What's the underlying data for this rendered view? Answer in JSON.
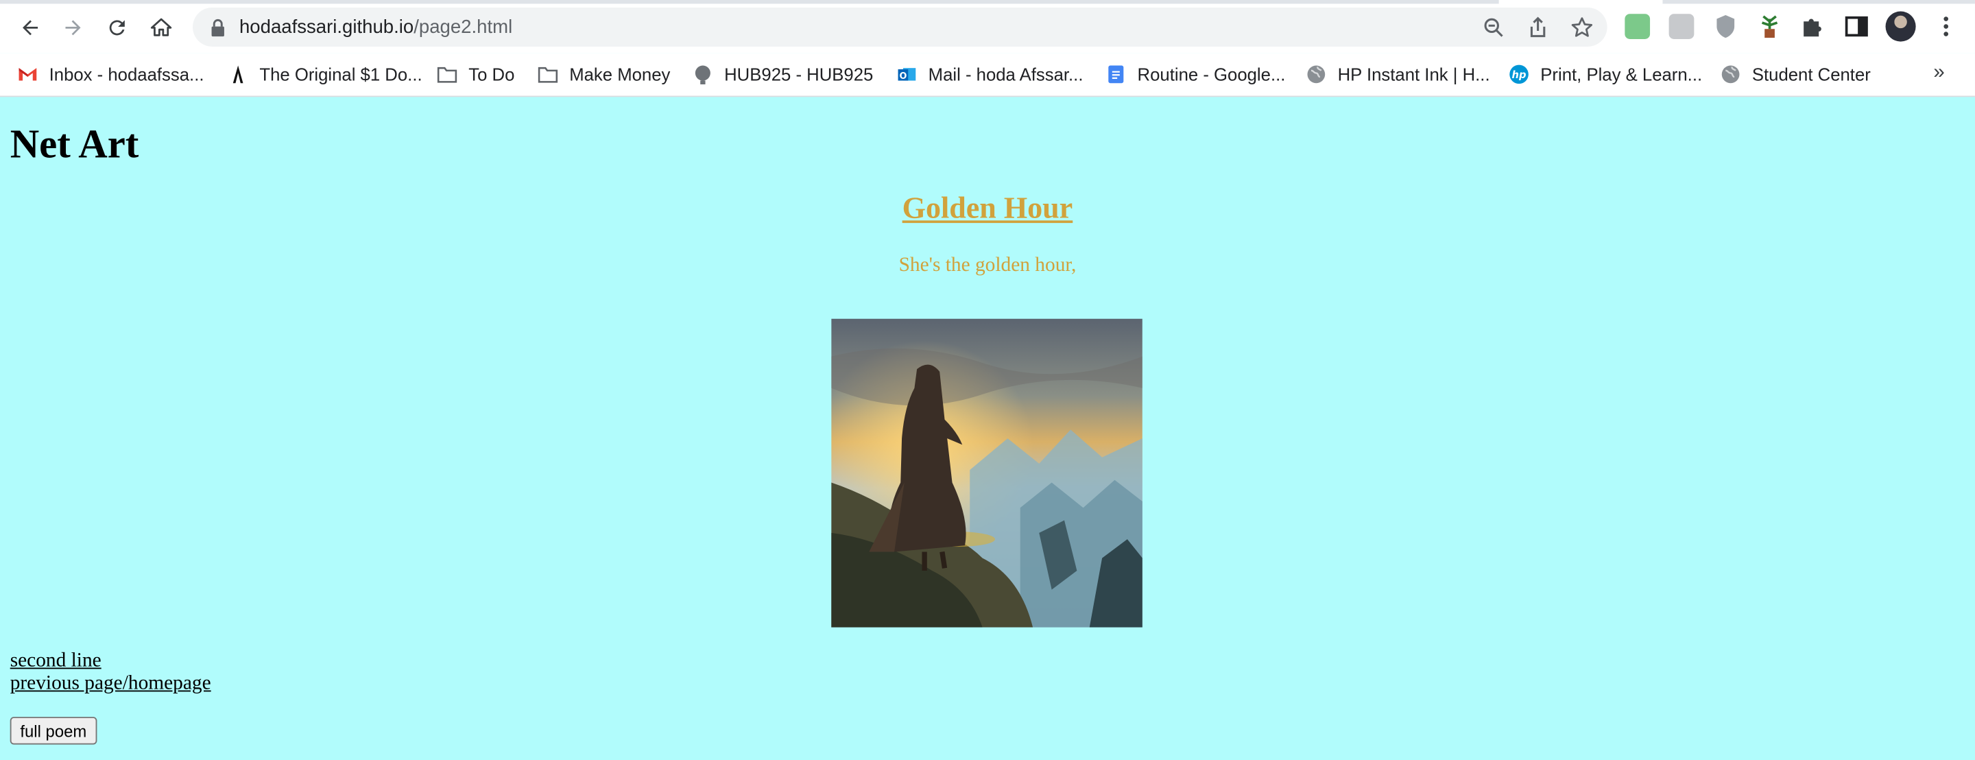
{
  "browser": {
    "url_host": "hodaafssari.github.io",
    "url_path": "/page2.html"
  },
  "bookmarks": [
    {
      "label": "Inbox - hodaafssa...",
      "icon": "gmail-icon"
    },
    {
      "label": "The Original $1 Do...",
      "icon": "brand-a-icon"
    },
    {
      "label": "To Do",
      "icon": "folder-icon"
    },
    {
      "label": "Make Money",
      "icon": "folder-icon"
    },
    {
      "label": "HUB925 - HUB925",
      "icon": "hub-icon"
    },
    {
      "label": "Mail - hoda Afssar...",
      "icon": "outlook-icon"
    },
    {
      "label": "Routine - Google...",
      "icon": "google-docs-icon"
    },
    {
      "label": "HP Instant Ink | H...",
      "icon": "globe-icon"
    },
    {
      "label": "Print, Play & Learn...",
      "icon": "hp-icon"
    },
    {
      "label": "Student Center",
      "icon": "globe-icon"
    }
  ],
  "bookmarks_overflow": "»",
  "page": {
    "heading": "Net Art",
    "poem_title": "Golden Hour",
    "poem_line": "She's the golden hour,",
    "links": [
      "second line",
      "previous page/homepage"
    ],
    "button": "full poem"
  },
  "colors": {
    "background": "#b1fcfc",
    "accent": "#d1a23c"
  }
}
